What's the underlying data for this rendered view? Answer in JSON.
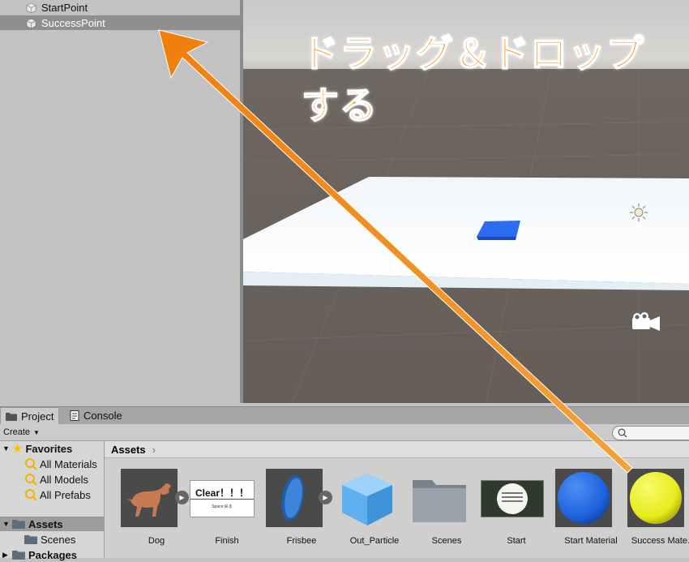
{
  "hierarchy": {
    "items": [
      {
        "label": "StartPoint",
        "selected": false
      },
      {
        "label": "SuccessPoint",
        "selected": true
      }
    ]
  },
  "scene": {
    "icons": [
      "sun-icon",
      "camera-icon"
    ]
  },
  "annotation": {
    "line1": "ドラッグ＆ドロップ",
    "line2": "する",
    "color": "#f79a22"
  },
  "tabs": {
    "project": "Project",
    "console": "Console"
  },
  "toolbar": {
    "create": "Create"
  },
  "sidebar": {
    "favorites": "Favorites",
    "favorite_items": [
      "All Materials",
      "All Models",
      "All Prefabs"
    ],
    "assets": "Assets",
    "assets_children": [
      "Scenes"
    ],
    "packages": "Packages"
  },
  "breadcrumb": "Assets",
  "assets": [
    {
      "label": "Dog",
      "icon": "dog-model-icon"
    },
    {
      "label": "Finish",
      "icon": "finish-image-icon",
      "caption": "Clear！！！",
      "subcaption": "Space:戻る"
    },
    {
      "label": "Frisbee",
      "icon": "frisbee-model-icon"
    },
    {
      "label": "Out_Particle",
      "icon": "prefab-cube-icon"
    },
    {
      "label": "Scenes",
      "icon": "folder-icon"
    },
    {
      "label": "Start",
      "icon": "start-image-icon"
    },
    {
      "label": "Start Material",
      "icon": "blue-sphere-icon",
      "color": "#1e62dd"
    },
    {
      "label": "Success Mate...",
      "icon": "yellow-sphere-icon",
      "color": "#e6ec1a"
    }
  ]
}
